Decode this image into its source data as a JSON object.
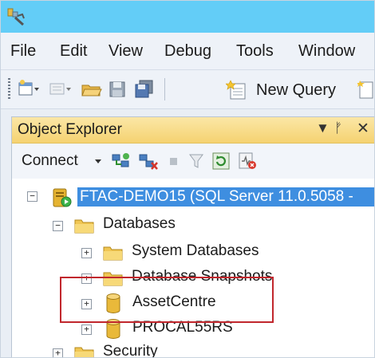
{
  "menu": {
    "items": [
      {
        "label": "File"
      },
      {
        "label": "Edit"
      },
      {
        "label": "View"
      },
      {
        "label": "Debug"
      },
      {
        "label": "Tools"
      },
      {
        "label": "Window"
      }
    ]
  },
  "toolbar": {
    "new_query_label": "New Query",
    "icons": [
      "new-project-icon",
      "add-item-icon",
      "open-file-icon",
      "save-icon",
      "save-all-icon",
      "new-query-icon",
      "new-file-icon"
    ]
  },
  "object_explorer": {
    "title": "Object Explorer",
    "header_controls": [
      "dropdown-arrow",
      "pin",
      "close"
    ],
    "connect_label": "Connect",
    "toolbar_icons": [
      "connect-object-explorer-icon",
      "disconnect-icon",
      "stop-icon",
      "filter-icon",
      "refresh-icon",
      "activity-monitor-icon"
    ],
    "tree": {
      "server": "FTAC-DEMO15 (SQL Server 11.0.5058 -",
      "databases_folder": "Databases",
      "database_items": [
        "System Databases",
        "Database Snapshots",
        "AssetCentre",
        "PROCAL55RS"
      ],
      "security_folder": "Security"
    }
  },
  "colors": {
    "title_bar": "#63cdf7",
    "selection": "#3e8ee0",
    "panel_header": "#f5d271",
    "highlight_box": "#c1272d"
  }
}
